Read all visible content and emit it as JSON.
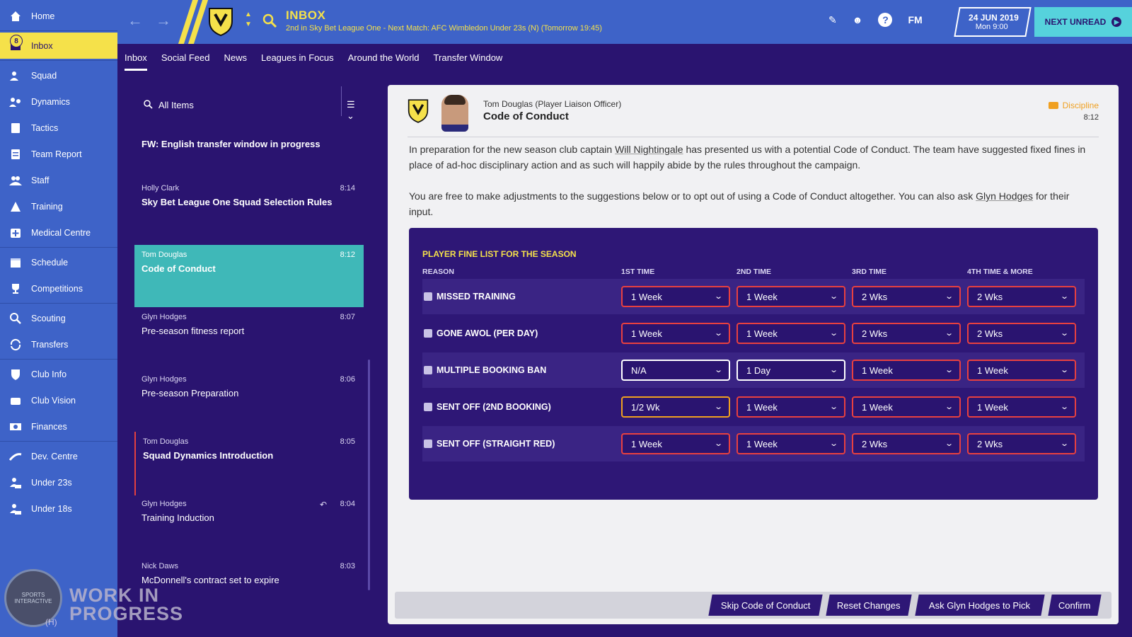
{
  "sidebar": {
    "inbox_badge": "8",
    "items": [
      {
        "label": "Home",
        "icon": "home-icon"
      },
      {
        "label": "Inbox",
        "icon": "inbox-icon"
      },
      {
        "label": "Squad",
        "icon": "squad-icon"
      },
      {
        "label": "Dynamics",
        "icon": "dynamics-icon"
      },
      {
        "label": "Tactics",
        "icon": "tactics-icon"
      },
      {
        "label": "Team Report",
        "icon": "report-icon"
      },
      {
        "label": "Staff",
        "icon": "staff-icon"
      },
      {
        "label": "Training",
        "icon": "training-icon"
      },
      {
        "label": "Medical Centre",
        "icon": "medical-icon"
      },
      {
        "label": "Schedule",
        "icon": "calendar-icon"
      },
      {
        "label": "Competitions",
        "icon": "trophy-icon"
      },
      {
        "label": "Scouting",
        "icon": "search-icon"
      },
      {
        "label": "Transfers",
        "icon": "transfer-icon"
      },
      {
        "label": "Club Info",
        "icon": "shield-icon"
      },
      {
        "label": "Club Vision",
        "icon": "vision-icon"
      },
      {
        "label": "Finances",
        "icon": "money-icon"
      },
      {
        "label": "Dev. Centre",
        "icon": "dev-icon"
      },
      {
        "label": "Under 23s",
        "icon": "u23-icon"
      },
      {
        "label": "Under 18s",
        "icon": "u18-icon"
      }
    ]
  },
  "topbar": {
    "title": "INBOX",
    "subtitle": "2nd in Sky Bet League One - Next Match: AFC Wimbledon Under 23s (N) (Tomorrow 19:45)",
    "fm_label": "FM",
    "date": "24 JUN 2019",
    "time": "Mon 9:00",
    "next_unread": "NEXT UNREAD"
  },
  "tabs": [
    "Inbox",
    "Social Feed",
    "News",
    "Leagues in Focus",
    "Around the World",
    "Transfer Window"
  ],
  "list": {
    "filter_label": "All Items",
    "messages": [
      {
        "from": "",
        "subject": "FW: English transfer window in progress",
        "time": ""
      },
      {
        "from": "Holly Clark",
        "subject": "Sky Bet League One Squad Selection Rules",
        "time": "8:14"
      },
      {
        "from": "Tom Douglas",
        "subject": "Code of Conduct",
        "time": "8:12"
      },
      {
        "from": "Glyn Hodges",
        "subject": "Pre-season fitness report",
        "time": "8:07"
      },
      {
        "from": "Glyn Hodges",
        "subject": "Pre-season Preparation",
        "time": "8:06"
      },
      {
        "from": "Tom Douglas",
        "subject": "Squad Dynamics Introduction",
        "time": "8:05"
      },
      {
        "from": "Glyn Hodges",
        "subject": "Training Induction",
        "time": "8:04"
      },
      {
        "from": "Nick Daws",
        "subject": "McDonnell's contract set to expire",
        "time": "8:03"
      }
    ]
  },
  "message": {
    "sender_name": "Tom Douglas",
    "sender_role": "(Player Liaison Officer)",
    "subject": "Code of Conduct",
    "tag": "Discipline",
    "time": "8:12",
    "p1_a": "In preparation for the new season club captain ",
    "p1_link": "Will Nightingale",
    "p1_b": " has presented us with a potential Code of Conduct. The team have suggested fixed fines in place of ad-hoc disciplinary action and as such will happily abide by the rules throughout the campaign.",
    "p2_a": "You are free to make adjustments to the suggestions below or to opt out of using a Code of Conduct altogether. You can also ask ",
    "p2_link": "Glyn Hodges",
    "p2_b": " for their input."
  },
  "fines": {
    "title": "PLAYER FINE LIST FOR THE SEASON",
    "headers": [
      "REASON",
      "1ST TIME",
      "2ND TIME",
      "3RD TIME",
      "4TH TIME & MORE"
    ],
    "rows": [
      {
        "reason": "MISSED TRAINING",
        "values": [
          "1 Week",
          "1 Week",
          "2 Wks",
          "2 Wks"
        ]
      },
      {
        "reason": "GONE AWOL (PER DAY)",
        "values": [
          "1 Week",
          "1 Week",
          "2 Wks",
          "2 Wks"
        ]
      },
      {
        "reason": "MULTIPLE BOOKING BAN",
        "values": [
          "N/A",
          "1 Day",
          "1 Week",
          "1 Week"
        ]
      },
      {
        "reason": "SENT OFF (2ND BOOKING)",
        "values": [
          "1/2 Wk",
          "1 Week",
          "1 Week",
          "1 Week"
        ]
      },
      {
        "reason": "SENT OFF (STRAIGHT RED)",
        "values": [
          "1 Week",
          "1 Week",
          "2 Wks",
          "2 Wks"
        ]
      }
    ]
  },
  "actions": {
    "skip": "Skip Code of Conduct",
    "reset": "Reset Changes",
    "ask": "Ask Glyn Hodges to Pick",
    "confirm": "Confirm"
  },
  "watermark": {
    "text_line1": "WORK IN",
    "text_line2": "PROGRESS",
    "logo_text": "SPORTS INTERACTIVE",
    "under": "(H)"
  },
  "colors": {
    "sidebar": "#3e63c8",
    "accent": "#f5e14a",
    "background": "#2a1470",
    "selected_message": "#3fb8b8",
    "fine_border": "#e84040"
  }
}
